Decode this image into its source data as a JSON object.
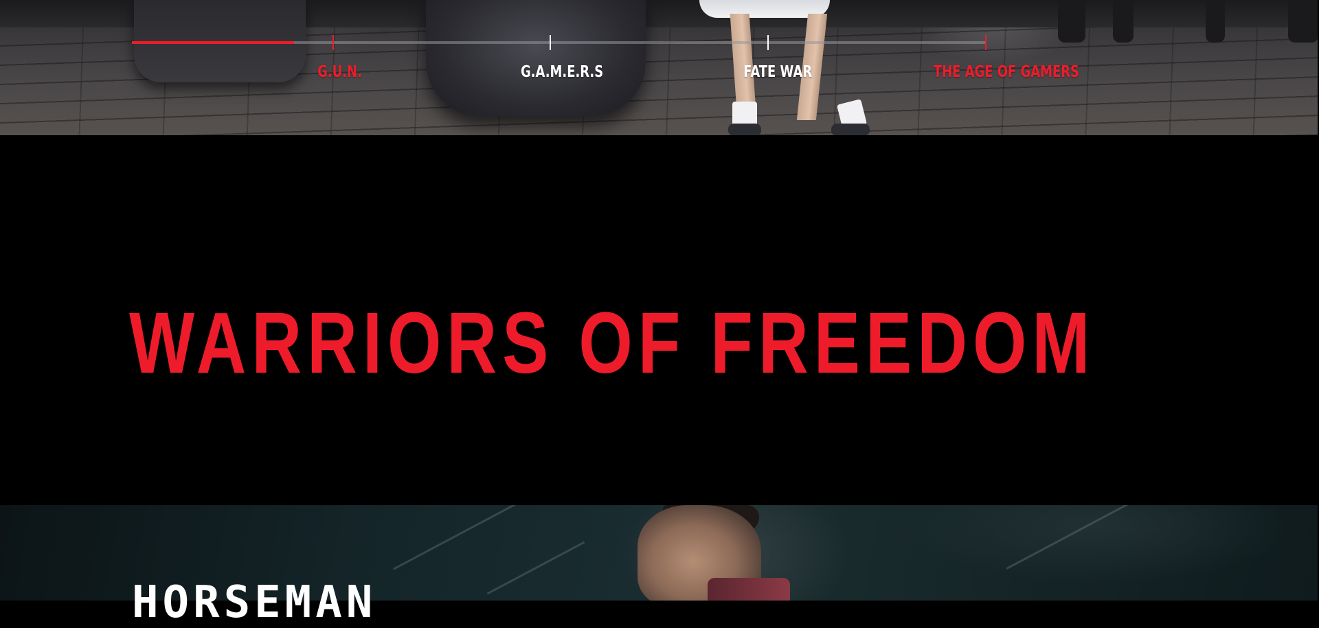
{
  "timeline": {
    "progress": 0.19,
    "items": [
      {
        "label": "G.U.N.",
        "state": "active",
        "color": "#ee1c2a"
      },
      {
        "label": "G.A.M.E.R.S",
        "state": "inactive",
        "color": "#ffffff"
      },
      {
        "label": "FATE WAR",
        "state": "inactive",
        "color": "#ffffff"
      },
      {
        "label": "THE AGE OF GAMERS",
        "state": "highlight",
        "color": "#ee1c2a"
      }
    ]
  },
  "headline": {
    "text": "WARRIORS OF FREEDOM",
    "color": "#ee1c2a"
  },
  "character": {
    "name": "HORSEMAN"
  },
  "colors": {
    "accent": "#ee1c2a",
    "background": "#000000",
    "text": "#ffffff"
  }
}
